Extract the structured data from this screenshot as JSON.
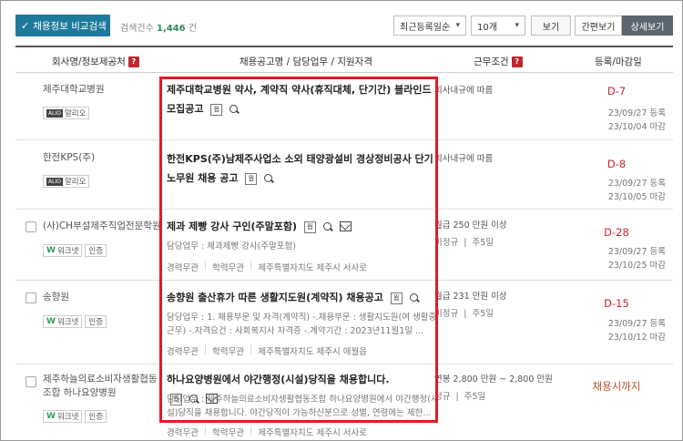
{
  "toolbar": {
    "compare_label": "채용정보 비교검색",
    "result_prefix": "검색건수",
    "result_count": "1,446",
    "result_suffix": "건",
    "sort_value": "최근등록일순",
    "count_value": "10개",
    "view_button": "보기",
    "simple_view": "간편보기",
    "detail_view": "상세보기"
  },
  "header": {
    "company": "회사명/정보제공처",
    "title": "채용공고명 / 담당업무 / 지원자격",
    "condition": "근무조건",
    "date": "등록/마감일",
    "help": "?"
  },
  "icons": {
    "doc": "뭡"
  },
  "rows": [
    {
      "company": "제주대학교병원",
      "badges": [
        "알리오"
      ],
      "title": "제주대학교병원 약사, 계약직 약사(휴직대체, 단기간) 블라인드 모집공고",
      "condition": "회사내규에 따름",
      "dday": "D-7",
      "registered": "23/09/27 등록",
      "deadline": "23/10/04 마감"
    },
    {
      "company": "한전KPS(주)",
      "badges": [
        "알리오"
      ],
      "title": "한전KPS(주)남제주사업소 소외 태양광설비 경상정비공사 단기노무원 채용 공고",
      "condition": "회사내규에 따름",
      "dday": "D-8",
      "registered": "23/09/27 등록",
      "deadline": "23/10/05 마감"
    },
    {
      "company": "(사)CH부설제주직업전문학원",
      "badges": [
        "워크넷",
        "인증"
      ],
      "title": "제과 제빵 강사 구인(주말포함)",
      "duty": "담당업무 : 제과제빵 강사(주말포함)",
      "meta": [
        "경력무관",
        "학력무관",
        "제주특별자치도 제주시 서사로"
      ],
      "cond_wage": "월급 250 만원 이상",
      "cond_type": "비정규",
      "cond_days": "주5일",
      "dday": "D-28",
      "registered": "23/09/27 등록",
      "deadline": "23/10/25 마감"
    },
    {
      "company": "송향원",
      "badges": [
        "워크넷",
        "인증"
      ],
      "title": "송향원 출산휴가 따른 생활지도원(계약직) 채용공고",
      "duty": "담당업무 : 1. 채용부문 및 자격(계약직) -.채용부문 : 생활지도원(여 생활중근무) -.자격요건 : 사회복지사 자격증 -.계약기간 : 2023년11월1일 ...",
      "meta": [
        "경력무관",
        "학력무관",
        "제주특별자치도 제주시 애월읍"
      ],
      "cond_wage": "월급 231 만원 이상",
      "cond_type": "비정규",
      "cond_days": "주5일",
      "dday": "D-15",
      "registered": "23/09/27 등록",
      "deadline": "23/10/12 마감"
    },
    {
      "company": "제주하늘의료소비자생활협동조합 하나요양병원",
      "badges": [
        "워크넷",
        "인증"
      ],
      "title": "하나요양병원에서 야간행정(시설)당직을 채용합니다.",
      "duty": "담당업무 : 제주하늘의료소비자생활협동조합 하나요양병원에서 야간행정(시설)당직을 채용합니다. 야간당직이 가능하신분으로 성별, 연령에는 제한...",
      "meta": [
        "경력무관",
        "학력무관",
        "제주특별자치도 제주시 서사로"
      ],
      "cond_wage": "연봉 2,800 만원 ~ 2,800 만원",
      "cond_type": "정규",
      "cond_days": "주5일",
      "dday": "채용시까지"
    }
  ],
  "colors": {
    "accent": "#1e7a9c",
    "highlight": "#e01b24",
    "dday": "#c0282d"
  }
}
